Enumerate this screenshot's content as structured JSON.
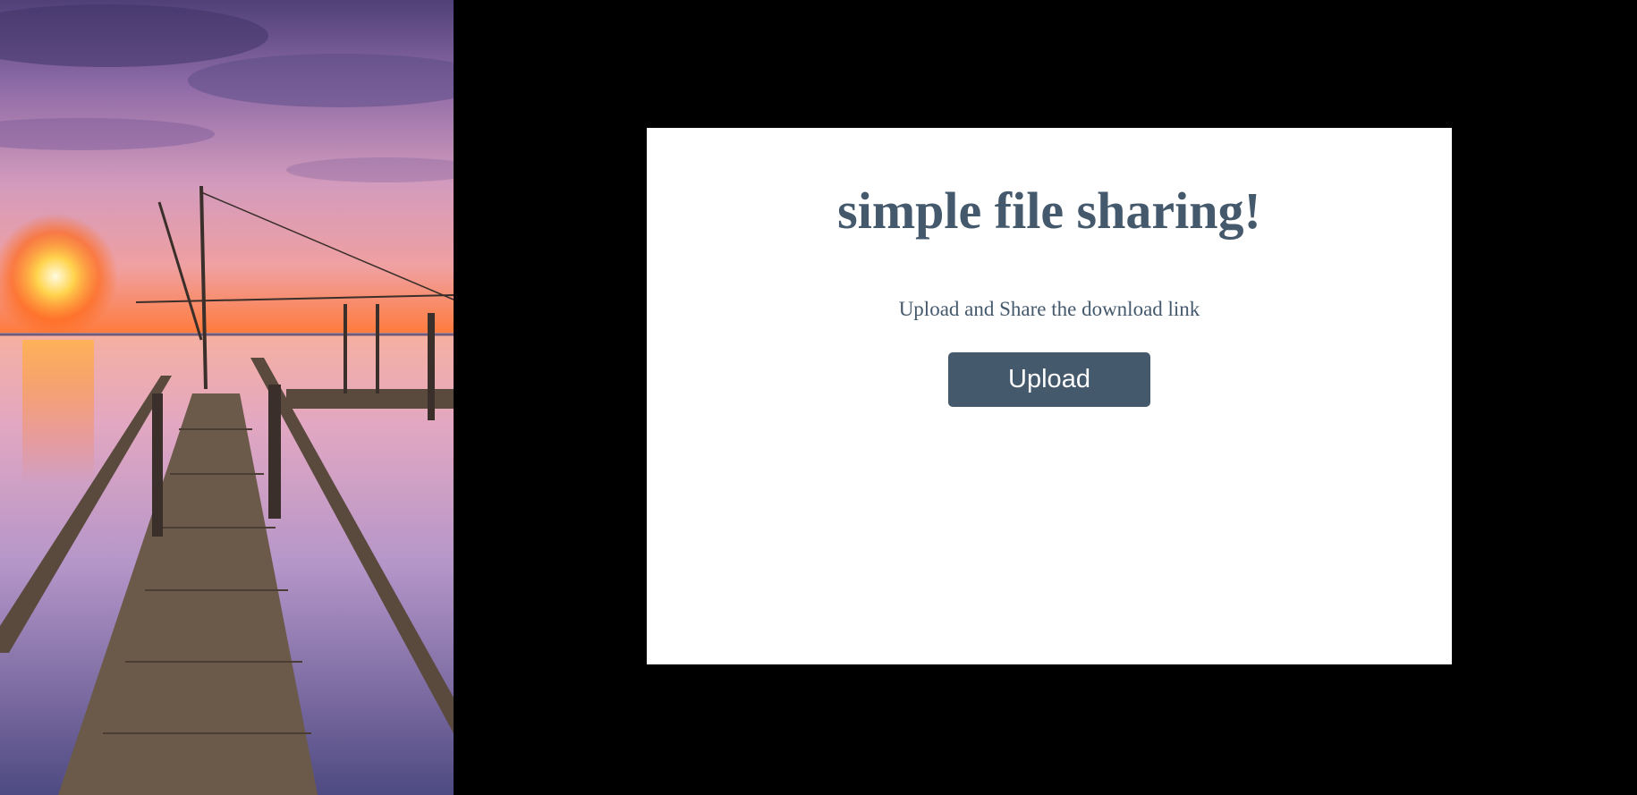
{
  "hero_image": {
    "scene": "sunset-pier-photo",
    "colors": {
      "sky_top": "#5d4a86",
      "sky_mid": "#c48bb6",
      "sun": "#ffe39a",
      "horizon": "#ff6a1a",
      "water": "#a98fc0",
      "wood": "#6b5a4a"
    }
  },
  "card": {
    "title": "simple file sharing!",
    "subtitle": "Upload and Share the download link",
    "upload_label": "Upload"
  },
  "colors": {
    "accent": "#45596c",
    "background": "#000000",
    "card": "#ffffff"
  }
}
